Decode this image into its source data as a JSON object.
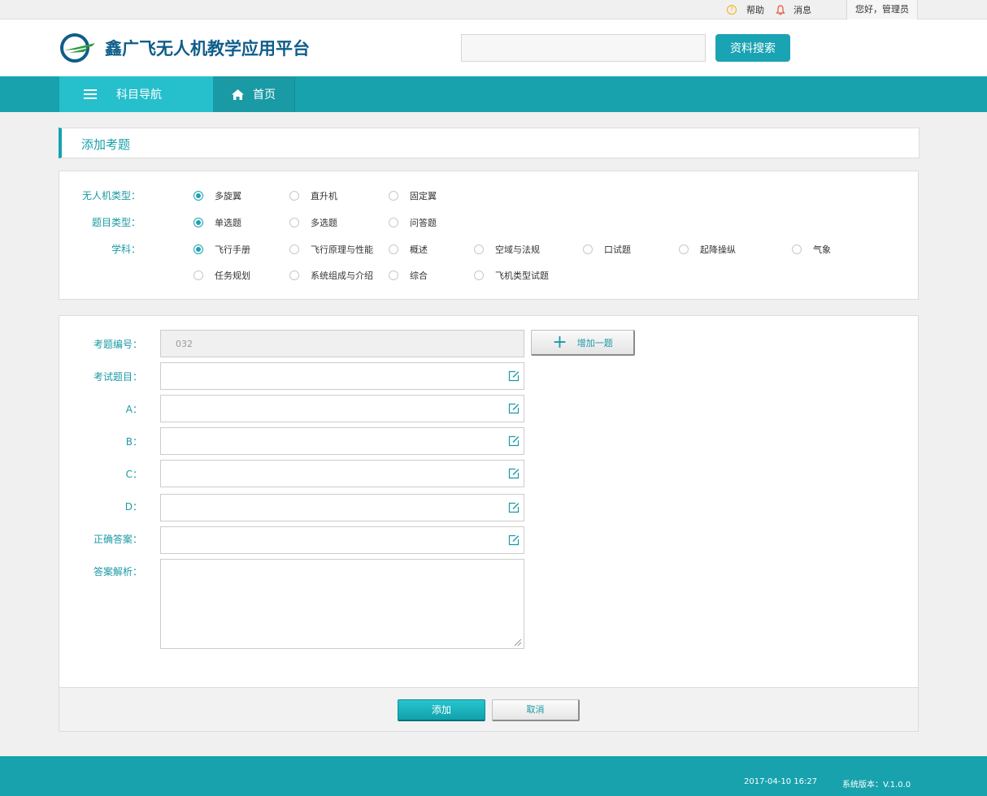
{
  "topbar": {
    "help": "帮助",
    "messages": "消息",
    "greeting": "您好，管理员"
  },
  "header": {
    "logo_text": "鑫广飞无人机教学应用平台",
    "search_value": "",
    "search_button": "资料搜索"
  },
  "nav": {
    "subject_nav": "科目导航",
    "home": "首页"
  },
  "page": {
    "title": "添加考题"
  },
  "filters": {
    "uav_type": {
      "label": "无人机类型：",
      "options": [
        "多旋翼",
        "直升机",
        "固定翼"
      ],
      "selected": "多旋翼"
    },
    "question_type": {
      "label": "题目类型：",
      "options": [
        "单选题",
        "多选题",
        "问答题"
      ],
      "selected": "单选题"
    },
    "subject": {
      "label": "学科：",
      "options": [
        "飞行手册",
        "飞行原理与性能",
        "概述",
        "空域与法规",
        "口试题",
        "起降操纵",
        "气象",
        "任务规划",
        "系统组成与介绍",
        "综合",
        "飞机类型试题"
      ],
      "selected": "飞行手册"
    }
  },
  "form": {
    "number_label": "考题编号：",
    "number_value": "032",
    "add_question_button": "增加一题",
    "question_label": "考试题目：",
    "a_label": "A：",
    "b_label": "B：",
    "c_label": "C：",
    "d_label": "D：",
    "answer_label": "正确答案：",
    "analysis_label": "答案解析：",
    "submit_button": "添加",
    "cancel_button": "取消"
  },
  "footer": {
    "datetime": "2017-04-10  16:27",
    "version": "系统版本：V.1.0.0"
  },
  "colors": {
    "primary": "#17a2ad",
    "primary_light": "#26bfcc",
    "logo_blue": "#0f5d8a",
    "logo_green": "#2f9a3e",
    "help_yellow": "#f2b20f",
    "bell_red": "#e2553a"
  },
  "icons": {
    "help": "help-circle-icon",
    "messages": "bell-icon",
    "menu": "menu-icon",
    "home": "home-icon",
    "edit": "edit-icon",
    "plus": "plus-icon"
  }
}
